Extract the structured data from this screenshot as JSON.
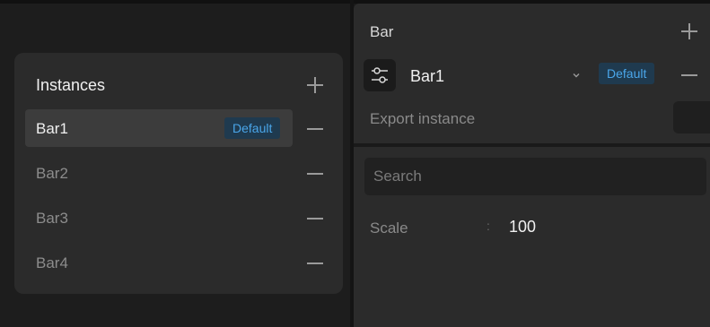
{
  "instances_panel": {
    "title": "Instances",
    "items": [
      {
        "label": "Bar1",
        "badge": "Default",
        "selected": true
      },
      {
        "label": "Bar2",
        "badge": "",
        "selected": false
      },
      {
        "label": "Bar3",
        "badge": "",
        "selected": false
      },
      {
        "label": "Bar4",
        "badge": "",
        "selected": false
      }
    ],
    "icons": {
      "add": "plus-icon",
      "remove": "minus-icon"
    }
  },
  "inspector": {
    "section_title": "Bar",
    "instance_selector": {
      "value": "Bar1",
      "badge": "Default",
      "icon": "sliders-icon"
    },
    "export_label": "Export instance"
  },
  "properties": {
    "search_placeholder": "Search",
    "rows": [
      {
        "label": "Scale",
        "separator": ":",
        "value": "100"
      }
    ]
  },
  "colors": {
    "accent": "#4aa6ea",
    "badge_bg": "#1f3a4f",
    "panel_bg": "#2b2b2b",
    "selected_row_bg": "#3c3c3c"
  }
}
